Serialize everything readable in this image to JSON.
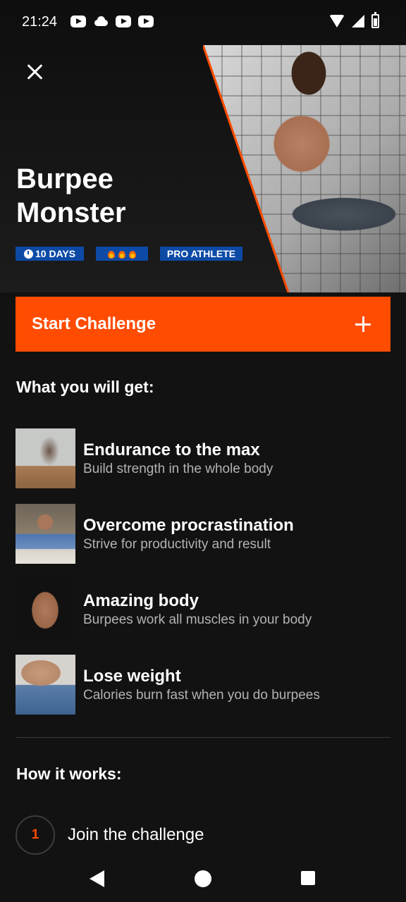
{
  "status_bar": {
    "time": "21:24",
    "left_icons": [
      "youtube-icon",
      "cloud-icon",
      "youtube-icon",
      "youtube-icon"
    ],
    "right_icons": [
      "wifi-icon",
      "signal-icon",
      "battery-icon"
    ]
  },
  "hero": {
    "title": "Burpee Monster",
    "badges": {
      "days": "10 DAYS",
      "difficulty_fire_count": 3,
      "level": "PRO ATHLETE"
    }
  },
  "start_button": {
    "label": "Start Challenge"
  },
  "benefits_section": {
    "title": "What you will get:",
    "items": [
      {
        "title": "Endurance to the max",
        "subtitle": "Build strength in the whole body"
      },
      {
        "title": "Overcome procrastination",
        "subtitle": "Strive for productivity and result"
      },
      {
        "title": "Amazing body",
        "subtitle": "Burpees work all muscles in your body"
      },
      {
        "title": "Lose weight",
        "subtitle": "Calories burn fast when you do burpees"
      }
    ]
  },
  "how_section": {
    "title": "How it works:",
    "steps": [
      {
        "number": "1",
        "label": "Join the challenge"
      }
    ]
  },
  "colors": {
    "accent": "#ff4c00",
    "badge": "#0c4aa6",
    "background": "#121212"
  }
}
